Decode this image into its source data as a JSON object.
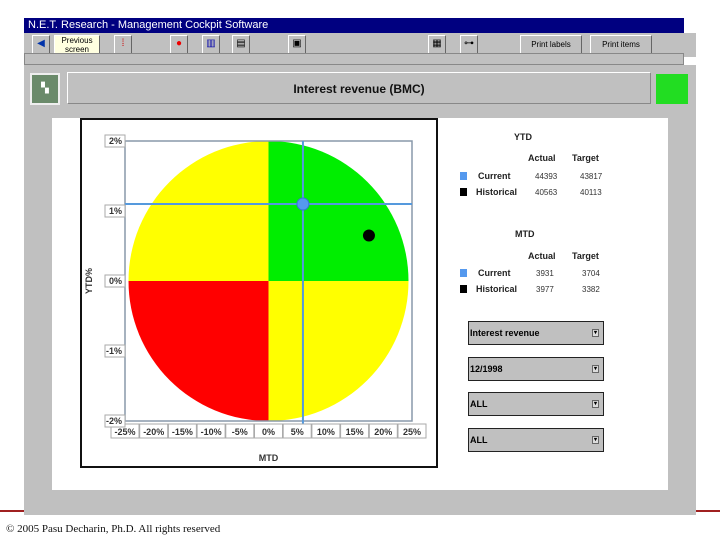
{
  "window": {
    "title": "N.E.T. Research - Management Cockpit Software"
  },
  "toolbar": {
    "previous_label": "Previous screen",
    "print_labels": "Print labels",
    "print_items": "Print items"
  },
  "header": {
    "title": "Interest revenue (BMC)",
    "status_color": "#22dd22"
  },
  "ytd": {
    "title": "YTD",
    "col_actual": "Actual",
    "col_target": "Target",
    "rows": [
      {
        "label": "Current",
        "actual": "44393",
        "target": "43817",
        "color": "#5599ee"
      },
      {
        "label": "Historical",
        "actual": "40563",
        "target": "40113",
        "color": "#000000"
      }
    ]
  },
  "mtd": {
    "title": "MTD",
    "col_actual": "Actual",
    "col_target": "Target",
    "rows": [
      {
        "label": "Current",
        "actual": "3931",
        "target": "3704",
        "color": "#5599ee"
      },
      {
        "label": "Historical",
        "actual": "3977",
        "target": "3382",
        "color": "#000000"
      }
    ]
  },
  "filters": [
    {
      "value": "Interest revenue"
    },
    {
      "value": "12/1998"
    },
    {
      "value": "ALL"
    },
    {
      "value": "ALL"
    }
  ],
  "chart_data": {
    "type": "scatter",
    "xlabel": "MTD",
    "ylabel": "YTD%",
    "xlim": [
      -25,
      25
    ],
    "ylim": [
      -2,
      2
    ],
    "x_ticks": [
      "-25%",
      "-20%",
      "-15%",
      "-10%",
      "-5%",
      "0%",
      "5%",
      "10%",
      "15%",
      "20%",
      "25%"
    ],
    "y_ticks": [
      "2%",
      "1%",
      "0%",
      "-1%",
      "-2%"
    ],
    "quadrants": {
      "top_left": "#ffff00",
      "top_right": "#00ee00",
      "bottom_left": "#ff0000",
      "bottom_right": "#ffff00"
    },
    "series": [
      {
        "name": "Current",
        "x": 6,
        "y": 1.1,
        "color": "#5599ee"
      },
      {
        "name": "Historical",
        "x": 17.5,
        "y": 0.65,
        "color": "#000000"
      }
    ]
  },
  "footer": {
    "copyright": "© 2005 Pasu Decharin, Ph.D. All rights reserved"
  }
}
